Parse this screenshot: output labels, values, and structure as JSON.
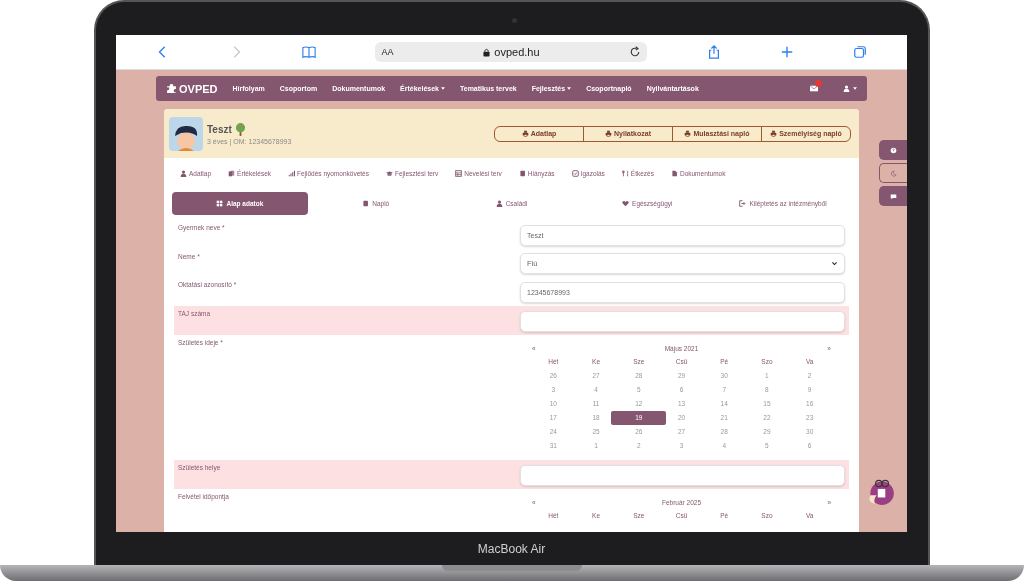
{
  "browser": {
    "text_size": "AA",
    "address": "ovped.hu"
  },
  "nav": {
    "logo": "OVPED",
    "items": [
      {
        "label": "Hírfolyam",
        "dropdown": false
      },
      {
        "label": "Csoportom",
        "dropdown": false
      },
      {
        "label": "Dokumentumok",
        "dropdown": false
      },
      {
        "label": "Értékelések",
        "dropdown": true
      },
      {
        "label": "Tematikus tervek",
        "dropdown": false
      },
      {
        "label": "Fejlesztés",
        "dropdown": true
      },
      {
        "label": "Csoportnapló",
        "dropdown": false
      },
      {
        "label": "Nyilvántartások",
        "dropdown": false
      }
    ],
    "notification": true
  },
  "profile": {
    "name": "Teszt",
    "info": "3 éves | OM: 12345678993",
    "buttons": [
      "Adatlap",
      "Nyilatkozat",
      "Mulasztási napló",
      "Személyiség napló"
    ]
  },
  "tabs": [
    "Adatlap",
    "Értékelések",
    "Fejlődés nyomonkövetés",
    "Fejlesztési terv",
    "Nevelési terv",
    "Hiányzás",
    "Igazolás",
    "Étkezés",
    "Dokumentumok"
  ],
  "subtabs": [
    {
      "label": "Alap adatok",
      "selected": true
    },
    {
      "label": "Napló",
      "selected": false
    },
    {
      "label": "Családi",
      "selected": false
    },
    {
      "label": "Egészségügyi",
      "selected": false
    },
    {
      "label": "Kiléptetés az intézményből",
      "selected": false
    }
  ],
  "form": [
    {
      "label": "Gyermek neve *",
      "kind": "text",
      "value": "Teszt",
      "invalid": false
    },
    {
      "label": "Neme *",
      "kind": "select",
      "value": "Fiú",
      "invalid": false
    },
    {
      "label": "Oktatási azonosító *",
      "kind": "text",
      "value": "12345678993",
      "invalid": false
    },
    {
      "label": "TAJ száma",
      "kind": "text",
      "invalid": true
    },
    {
      "label": "Születés ideje *",
      "kind": "calendar",
      "invalid": false,
      "calendar": {
        "prev": "«",
        "month": "Május 2021",
        "next": "»",
        "weekdays": [
          "Hét",
          "Ke",
          "Sze",
          "Csü",
          "Pé",
          "Szo",
          "Va"
        ],
        "weeks": [
          [
            {
              "day": "26",
              "selected": false
            },
            {
              "day": "27",
              "selected": false
            },
            {
              "day": "28",
              "selected": false
            },
            {
              "day": "29",
              "selected": false
            },
            {
              "day": "30",
              "selected": false
            },
            {
              "day": "1",
              "selected": false
            },
            {
              "day": "2",
              "selected": false
            }
          ],
          [
            {
              "day": "3",
              "selected": false
            },
            {
              "day": "4",
              "selected": false
            },
            {
              "day": "5",
              "selected": false
            },
            {
              "day": "6",
              "selected": false
            },
            {
              "day": "7",
              "selected": false
            },
            {
              "day": "8",
              "selected": false
            },
            {
              "day": "9",
              "selected": false
            }
          ],
          [
            {
              "day": "10",
              "selected": false
            },
            {
              "day": "11",
              "selected": false
            },
            {
              "day": "12",
              "selected": false
            },
            {
              "day": "13",
              "selected": false
            },
            {
              "day": "14",
              "selected": false
            },
            {
              "day": "15",
              "selected": false
            },
            {
              "day": "16",
              "selected": false
            }
          ],
          [
            {
              "day": "17",
              "selected": false
            },
            {
              "day": "18",
              "selected": false
            },
            {
              "day": "19",
              "selected": true
            },
            {
              "day": "20",
              "selected": false
            },
            {
              "day": "21",
              "selected": false
            },
            {
              "day": "22",
              "selected": false
            },
            {
              "day": "23",
              "selected": false
            }
          ],
          [
            {
              "day": "24",
              "selected": false
            },
            {
              "day": "25",
              "selected": false
            },
            {
              "day": "26",
              "selected": false
            },
            {
              "day": "27",
              "selected": false
            },
            {
              "day": "28",
              "selected": false
            },
            {
              "day": "29",
              "selected": false
            },
            {
              "day": "30",
              "selected": false
            }
          ],
          [
            {
              "day": "31",
              "selected": false
            },
            {
              "day": "1",
              "selected": false
            },
            {
              "day": "2",
              "selected": false
            },
            {
              "day": "3",
              "selected": false
            },
            {
              "day": "4",
              "selected": false
            },
            {
              "day": "5",
              "selected": false
            },
            {
              "day": "6",
              "selected": false
            }
          ]
        ]
      }
    },
    {
      "label": "Születés helye",
      "kind": "text",
      "invalid": true
    },
    {
      "label": "Felvétel időpontja",
      "kind": "calendar",
      "invalid": false,
      "calendar": {
        "prev": "«",
        "month": "Február 2025",
        "next": "»",
        "weekdays": [
          "Hét",
          "Ke",
          "Sze",
          "Csü",
          "Pé",
          "Szo",
          "Va"
        ]
      }
    }
  ],
  "side_buttons": [
    {
      "active": true
    },
    {
      "active": false
    },
    {
      "active": true
    }
  ],
  "device_label": "MacBook Air"
}
